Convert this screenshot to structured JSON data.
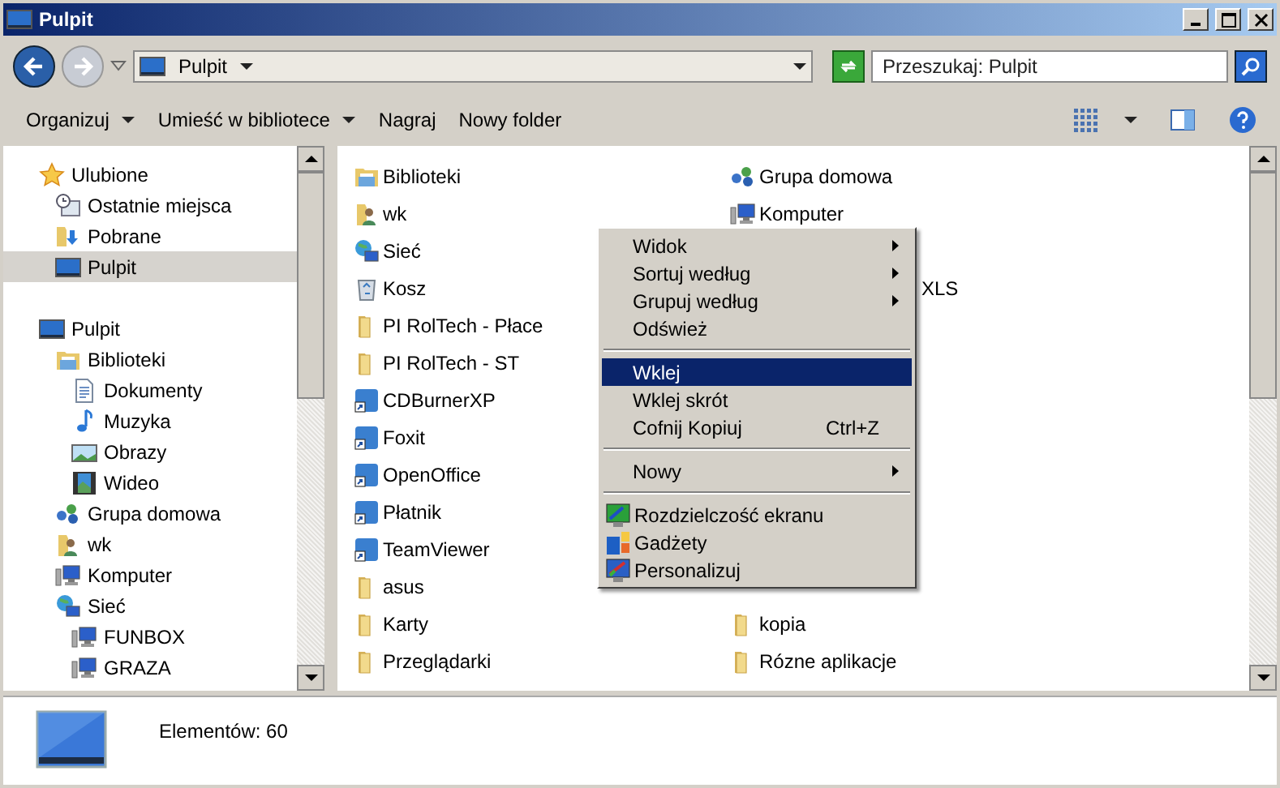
{
  "window": {
    "title": "Pulpit"
  },
  "address": {
    "location": "Pulpit",
    "search_placeholder": "Przeszukaj: Pulpit"
  },
  "toolbar": [
    {
      "label": "Organizuj",
      "dropdown": true
    },
    {
      "label": "Umieść w bibliotece",
      "dropdown": true
    },
    {
      "label": "Nagraj",
      "dropdown": false
    },
    {
      "label": "Nowy folder",
      "dropdown": false
    }
  ],
  "sidebar": {
    "items": [
      {
        "label": "Ulubione",
        "kind": "star",
        "selected": false,
        "children": [
          {
            "label": "Ostatnie miejsca",
            "kind": "recent",
            "selected": false
          },
          {
            "label": "Pobrane",
            "kind": "download",
            "selected": false
          },
          {
            "label": "Pulpit",
            "kind": "desktop",
            "selected": true
          }
        ]
      },
      {
        "label": "Pulpit",
        "kind": "desktop",
        "selected": false,
        "children": [
          {
            "label": "Biblioteki",
            "kind": "library",
            "selected": false,
            "children": [
              {
                "label": "Dokumenty",
                "kind": "document",
                "selected": false
              },
              {
                "label": "Muzyka",
                "kind": "music",
                "selected": false
              },
              {
                "label": "Obrazy",
                "kind": "image",
                "selected": false
              },
              {
                "label": "Wideo",
                "kind": "video",
                "selected": false
              }
            ]
          },
          {
            "label": "Grupa domowa",
            "kind": "homegroup",
            "selected": false
          },
          {
            "label": "wk",
            "kind": "user",
            "selected": false
          },
          {
            "label": "Komputer",
            "kind": "computer",
            "selected": false
          },
          {
            "label": "Sieć",
            "kind": "network",
            "selected": false,
            "children": [
              {
                "label": "FUNBOX",
                "kind": "computer",
                "selected": false
              },
              {
                "label": "GRAZA",
                "kind": "computer",
                "selected": false
              }
            ]
          }
        ]
      }
    ]
  },
  "files": {
    "column_1": [
      {
        "label": "Biblioteki",
        "kind": "library"
      },
      {
        "label": "wk",
        "kind": "user"
      },
      {
        "label": "Sieć",
        "kind": "network"
      },
      {
        "label": "Kosz",
        "kind": "bin"
      },
      {
        "label": "PI RolTech - Płace",
        "kind": "folder"
      },
      {
        "label": "PI RolTech - ST",
        "kind": "folder"
      },
      {
        "label": "CDBurnerXP",
        "kind": "app"
      },
      {
        "label": "Foxit",
        "kind": "app"
      },
      {
        "label": "OpenOffice",
        "kind": "app"
      },
      {
        "label": "Płatnik",
        "kind": "app"
      },
      {
        "label": "TeamViewer",
        "kind": "app"
      },
      {
        "label": "asus",
        "kind": "folder"
      },
      {
        "label": "Karty",
        "kind": "folder"
      },
      {
        "label": "Przeglądarki",
        "kind": "folder"
      }
    ],
    "column_2": [
      {
        "label": "Grupa domowa",
        "kind": "homegroup"
      },
      {
        "label": "Komputer",
        "kind": "computer"
      },
      {
        "label": "XLS",
        "kind": "partial"
      },
      {
        "label": "kopia",
        "kind": "folder"
      },
      {
        "label": "Rózne aplikacje",
        "kind": "folder"
      }
    ]
  },
  "context_menu": [
    {
      "kind": "item",
      "label": "Widok",
      "submenu": true,
      "selected": false
    },
    {
      "kind": "item",
      "label": "Sortuj według",
      "submenu": true,
      "selected": false
    },
    {
      "kind": "item",
      "label": "Grupuj według",
      "submenu": true,
      "selected": false
    },
    {
      "kind": "item",
      "label": "Odśwież",
      "submenu": false,
      "selected": false
    },
    {
      "kind": "separator"
    },
    {
      "kind": "item",
      "label": "Wklej",
      "submenu": false,
      "selected": true
    },
    {
      "kind": "item",
      "label": "Wklej skrót",
      "submenu": false,
      "selected": false
    },
    {
      "kind": "item",
      "label": "Cofnij Kopiuj",
      "shortcut": "Ctrl+Z",
      "submenu": false,
      "selected": false
    },
    {
      "kind": "separator"
    },
    {
      "kind": "item",
      "label": "Nowy",
      "submenu": true,
      "selected": false
    },
    {
      "kind": "separator"
    },
    {
      "kind": "resolution",
      "label": "Rozdzielczość ekranu",
      "selected": false
    },
    {
      "kind": "gadgets",
      "label": "Gadżety",
      "selected": false
    },
    {
      "kind": "personalize",
      "label": "Personalizuj",
      "selected": false
    }
  ],
  "status_bar": {
    "text": "Elementów: 60"
  }
}
